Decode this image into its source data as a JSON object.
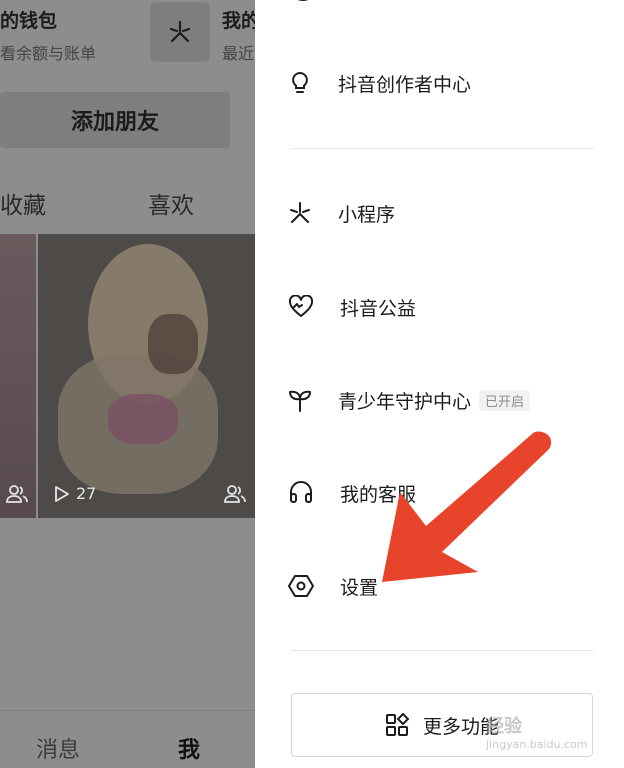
{
  "profile": {
    "wallet_title": "的钱包",
    "wallet_subtitle": "看余额与账单",
    "mini_title": "我的",
    "mini_subtitle": "最近",
    "add_friend": "添加朋友",
    "tabs": {
      "favorites": "收藏",
      "likes": "喜欢"
    },
    "play_count": "27",
    "bottom_nav": {
      "messages": "消息",
      "me": "我"
    }
  },
  "drawer": {
    "items": [
      {
        "label": "抖音创作者中心",
        "icon": "lightbulb-icon"
      },
      {
        "label": "小程序",
        "icon": "mini-program-icon"
      },
      {
        "label": "抖音公益",
        "icon": "charity-heart-icon"
      },
      {
        "label": "青少年守护中心",
        "icon": "sprout-icon",
        "badge": "已开启"
      },
      {
        "label": "我的客服",
        "icon": "headset-icon"
      },
      {
        "label": "设置",
        "icon": "settings-hexagon-icon"
      }
    ],
    "more_button": "更多功能"
  },
  "watermark": {
    "text": "经验",
    "subtext": "jingyan.baidu.com"
  },
  "colors": {
    "accent_arrow": "#e8432b",
    "dim_overlay": "#8d8d8d"
  }
}
